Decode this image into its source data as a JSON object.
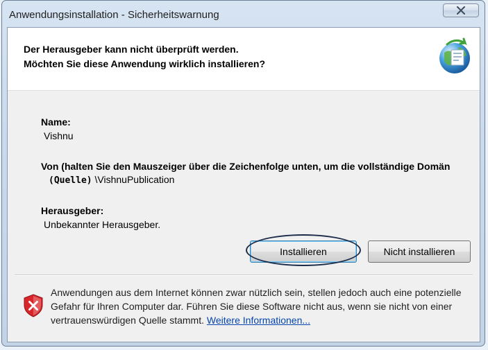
{
  "window": {
    "title": "Anwendungsinstallation - Sicherheitswarnung"
  },
  "header": {
    "line1": "Der Herausgeber kann nicht überprüft werden.",
    "line2": "Möchten Sie diese Anwendung wirklich installieren?"
  },
  "details": {
    "name_label": "Name:",
    "name_value": "Vishnu",
    "from_label": "Von (halten Sie den Mauszeiger über die Zeichenfolge unten, um die vollständige Domän",
    "from_value_prefix": "(Quelle)",
    "from_value": "\\VishnuPublication",
    "publisher_label": "Herausgeber:",
    "publisher_value": "Unbekannter Herausgeber."
  },
  "buttons": {
    "install": "Installieren",
    "dont_install": "Nicht installieren"
  },
  "warning": {
    "text": "Anwendungen aus dem Internet können zwar nützlich sein, stellen jedoch auch eine potenzielle Gefahr für Ihren Computer dar. Führen Sie diese Software nicht aus, wenn sie nicht von einer vertrauenswürdigen Quelle stammt.",
    "link": "Weitere Informationen..."
  },
  "icons": {
    "close": "close-icon",
    "app": "globe-install-icon",
    "warning": "security-shield-icon"
  },
  "colors": {
    "link": "#0645ad",
    "shield_red": "#d8262b",
    "highlight": "#1b2b4a"
  }
}
